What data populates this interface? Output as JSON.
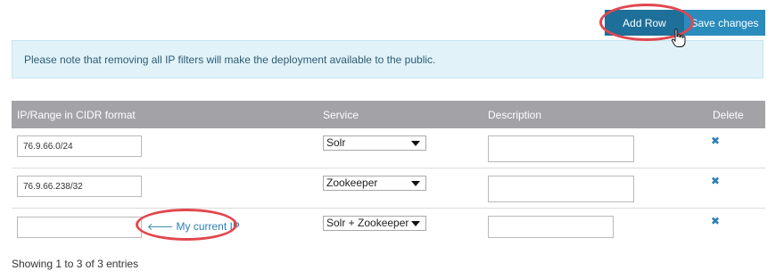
{
  "toolbar": {
    "add_row_label": "Add Row",
    "save_changes_label": "Save changes"
  },
  "notice": {
    "text": "Please note that removing all IP filters will make the deployment available to the public."
  },
  "table": {
    "headers": {
      "ip": "IP/Range in CIDR format",
      "service": "Service",
      "description": "Description",
      "delete": "Delete"
    },
    "rows": [
      {
        "ip": "76.9.66.0/24",
        "service": "Solr",
        "description": ""
      },
      {
        "ip": "76.9.66.238/32",
        "service": "Zookeeper",
        "description": ""
      },
      {
        "ip": "",
        "service": "Solr + Zookeeper",
        "description": "",
        "current_ip_label": "My current IP"
      }
    ]
  },
  "footer": {
    "summary": "Showing 1 to 3 of 3 entries"
  },
  "icons": {
    "delete": "close-icon",
    "arrow": "arrow-left-icon",
    "pointer": "hand-pointer-icon",
    "select": "chevron-down-icon"
  },
  "colors": {
    "add_row": "#1e6f9a",
    "save_changes": "#2a8bbd",
    "notice_bg": "#e1f2f9",
    "header_bg": "#a3a3a7",
    "highlight_ring": "#e2474f",
    "link": "#2a7fb0"
  }
}
